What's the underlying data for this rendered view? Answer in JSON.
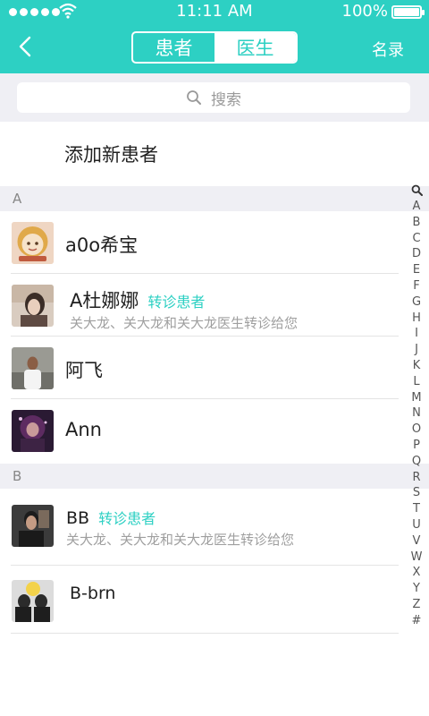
{
  "status_bar": {
    "time": "11:11 AM",
    "battery": "100%"
  },
  "nav": {
    "tab_patients": "患者",
    "tab_doctors": "医生",
    "roster": "名录"
  },
  "search": {
    "placeholder": "搜索"
  },
  "add_patient": "添加新患者",
  "sections": [
    {
      "letter": "A",
      "rows": [
        {
          "name": "a0o希宝",
          "tag": "",
          "subtitle": ""
        },
        {
          "name": "A杜娜娜",
          "tag": "转诊患者",
          "subtitle": "关大龙、关大龙和关大龙医生转诊给您"
        },
        {
          "name": "阿飞",
          "tag": "",
          "subtitle": ""
        },
        {
          "name": "Ann",
          "tag": "",
          "subtitle": ""
        }
      ]
    },
    {
      "letter": "B",
      "rows": [
        {
          "name": "BB",
          "tag": "转诊患者",
          "subtitle": "关大龙、关大龙和关大龙医生转诊给您"
        },
        {
          "name": "B-brn",
          "tag": "",
          "subtitle": ""
        }
      ]
    }
  ],
  "index_letters": [
    "A",
    "B",
    "C",
    "D",
    "E",
    "F",
    "G",
    "H",
    "I",
    "J",
    "K",
    "L",
    "M",
    "N",
    "O",
    "P",
    "Q",
    "R",
    "S",
    "T",
    "U",
    "V",
    "W",
    "X",
    "Y",
    "Z",
    "#"
  ],
  "colors": {
    "accent": "#2dd0c3",
    "section_bg": "#efeff4"
  }
}
